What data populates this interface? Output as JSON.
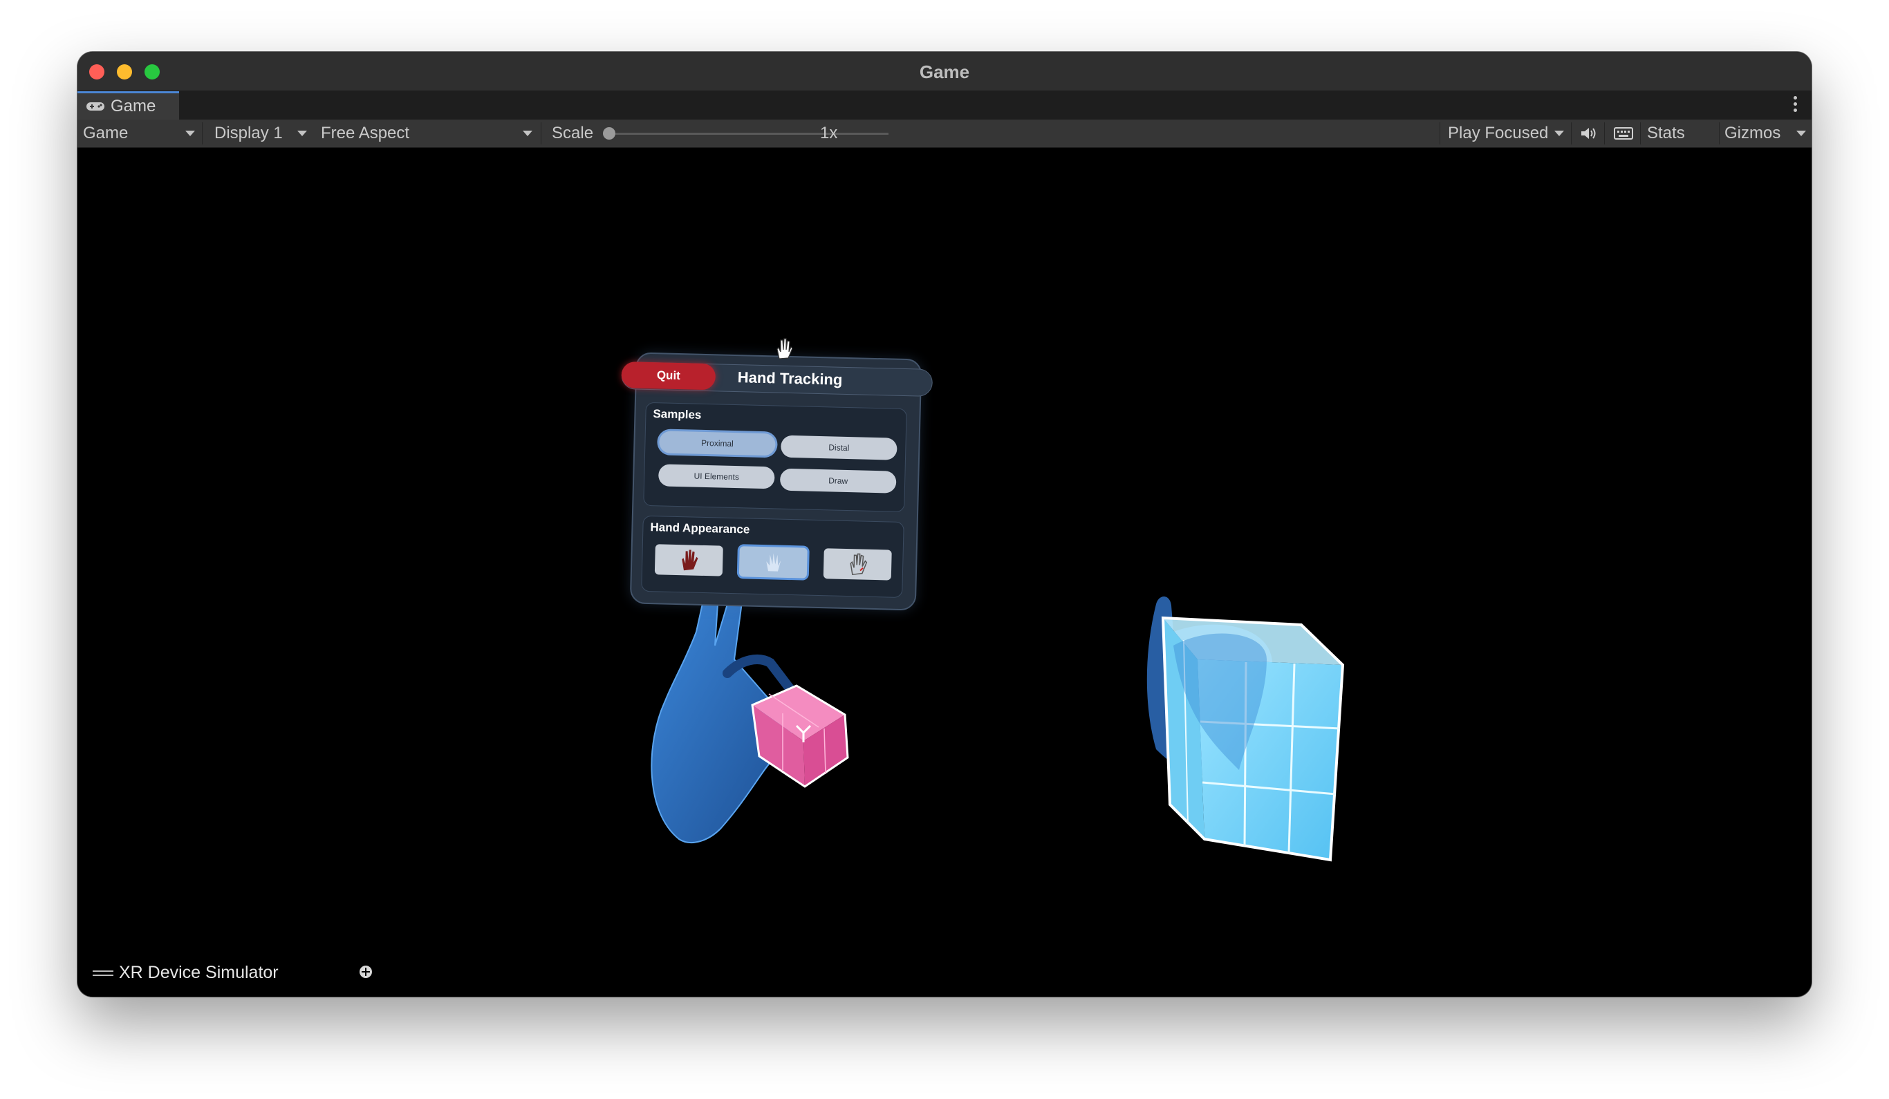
{
  "window": {
    "title": "Game"
  },
  "tab": {
    "label": "Game",
    "icon": "gamepad-icon"
  },
  "toolbar": {
    "view_select": "Game",
    "display_select": "Display 1",
    "aspect_select": "Free Aspect",
    "scale_label": "Scale",
    "scale_value": "1x",
    "play_mode": "Play Focused",
    "stats_label": "Stats",
    "gizmos_label": "Gizmos"
  },
  "panel": {
    "quit_label": "Quit",
    "title": "Hand Tracking",
    "samples_label": "Samples",
    "samples": [
      "Proximal",
      "Distal",
      "UI Elements",
      "Draw"
    ],
    "appearance_label": "Hand Appearance"
  },
  "bottom": {
    "simulator_label": "XR Device Simulator"
  },
  "colors": {
    "accent": "#4b86d4",
    "quit": "#b8212c",
    "hand": "#2f6fbf",
    "pink_cube": "#e86aa8",
    "blue_cube": "#7ed7f7"
  }
}
